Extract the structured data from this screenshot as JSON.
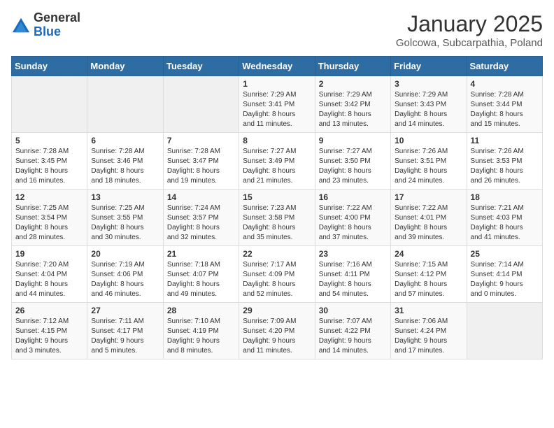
{
  "logo": {
    "general": "General",
    "blue": "Blue"
  },
  "header": {
    "month": "January 2025",
    "location": "Golcowa, Subcarpathia, Poland"
  },
  "days_of_week": [
    "Sunday",
    "Monday",
    "Tuesday",
    "Wednesday",
    "Thursday",
    "Friday",
    "Saturday"
  ],
  "weeks": [
    [
      {
        "day": "",
        "info": ""
      },
      {
        "day": "",
        "info": ""
      },
      {
        "day": "",
        "info": ""
      },
      {
        "day": "1",
        "info": "Sunrise: 7:29 AM\nSunset: 3:41 PM\nDaylight: 8 hours\nand 11 minutes."
      },
      {
        "day": "2",
        "info": "Sunrise: 7:29 AM\nSunset: 3:42 PM\nDaylight: 8 hours\nand 13 minutes."
      },
      {
        "day": "3",
        "info": "Sunrise: 7:29 AM\nSunset: 3:43 PM\nDaylight: 8 hours\nand 14 minutes."
      },
      {
        "day": "4",
        "info": "Sunrise: 7:28 AM\nSunset: 3:44 PM\nDaylight: 8 hours\nand 15 minutes."
      }
    ],
    [
      {
        "day": "5",
        "info": "Sunrise: 7:28 AM\nSunset: 3:45 PM\nDaylight: 8 hours\nand 16 minutes."
      },
      {
        "day": "6",
        "info": "Sunrise: 7:28 AM\nSunset: 3:46 PM\nDaylight: 8 hours\nand 18 minutes."
      },
      {
        "day": "7",
        "info": "Sunrise: 7:28 AM\nSunset: 3:47 PM\nDaylight: 8 hours\nand 19 minutes."
      },
      {
        "day": "8",
        "info": "Sunrise: 7:27 AM\nSunset: 3:49 PM\nDaylight: 8 hours\nand 21 minutes."
      },
      {
        "day": "9",
        "info": "Sunrise: 7:27 AM\nSunset: 3:50 PM\nDaylight: 8 hours\nand 23 minutes."
      },
      {
        "day": "10",
        "info": "Sunrise: 7:26 AM\nSunset: 3:51 PM\nDaylight: 8 hours\nand 24 minutes."
      },
      {
        "day": "11",
        "info": "Sunrise: 7:26 AM\nSunset: 3:53 PM\nDaylight: 8 hours\nand 26 minutes."
      }
    ],
    [
      {
        "day": "12",
        "info": "Sunrise: 7:25 AM\nSunset: 3:54 PM\nDaylight: 8 hours\nand 28 minutes."
      },
      {
        "day": "13",
        "info": "Sunrise: 7:25 AM\nSunset: 3:55 PM\nDaylight: 8 hours\nand 30 minutes."
      },
      {
        "day": "14",
        "info": "Sunrise: 7:24 AM\nSunset: 3:57 PM\nDaylight: 8 hours\nand 32 minutes."
      },
      {
        "day": "15",
        "info": "Sunrise: 7:23 AM\nSunset: 3:58 PM\nDaylight: 8 hours\nand 35 minutes."
      },
      {
        "day": "16",
        "info": "Sunrise: 7:22 AM\nSunset: 4:00 PM\nDaylight: 8 hours\nand 37 minutes."
      },
      {
        "day": "17",
        "info": "Sunrise: 7:22 AM\nSunset: 4:01 PM\nDaylight: 8 hours\nand 39 minutes."
      },
      {
        "day": "18",
        "info": "Sunrise: 7:21 AM\nSunset: 4:03 PM\nDaylight: 8 hours\nand 41 minutes."
      }
    ],
    [
      {
        "day": "19",
        "info": "Sunrise: 7:20 AM\nSunset: 4:04 PM\nDaylight: 8 hours\nand 44 minutes."
      },
      {
        "day": "20",
        "info": "Sunrise: 7:19 AM\nSunset: 4:06 PM\nDaylight: 8 hours\nand 46 minutes."
      },
      {
        "day": "21",
        "info": "Sunrise: 7:18 AM\nSunset: 4:07 PM\nDaylight: 8 hours\nand 49 minutes."
      },
      {
        "day": "22",
        "info": "Sunrise: 7:17 AM\nSunset: 4:09 PM\nDaylight: 8 hours\nand 52 minutes."
      },
      {
        "day": "23",
        "info": "Sunrise: 7:16 AM\nSunset: 4:11 PM\nDaylight: 8 hours\nand 54 minutes."
      },
      {
        "day": "24",
        "info": "Sunrise: 7:15 AM\nSunset: 4:12 PM\nDaylight: 8 hours\nand 57 minutes."
      },
      {
        "day": "25",
        "info": "Sunrise: 7:14 AM\nSunset: 4:14 PM\nDaylight: 9 hours\nand 0 minutes."
      }
    ],
    [
      {
        "day": "26",
        "info": "Sunrise: 7:12 AM\nSunset: 4:15 PM\nDaylight: 9 hours\nand 3 minutes."
      },
      {
        "day": "27",
        "info": "Sunrise: 7:11 AM\nSunset: 4:17 PM\nDaylight: 9 hours\nand 5 minutes."
      },
      {
        "day": "28",
        "info": "Sunrise: 7:10 AM\nSunset: 4:19 PM\nDaylight: 9 hours\nand 8 minutes."
      },
      {
        "day": "29",
        "info": "Sunrise: 7:09 AM\nSunset: 4:20 PM\nDaylight: 9 hours\nand 11 minutes."
      },
      {
        "day": "30",
        "info": "Sunrise: 7:07 AM\nSunset: 4:22 PM\nDaylight: 9 hours\nand 14 minutes."
      },
      {
        "day": "31",
        "info": "Sunrise: 7:06 AM\nSunset: 4:24 PM\nDaylight: 9 hours\nand 17 minutes."
      },
      {
        "day": "",
        "info": ""
      }
    ]
  ]
}
